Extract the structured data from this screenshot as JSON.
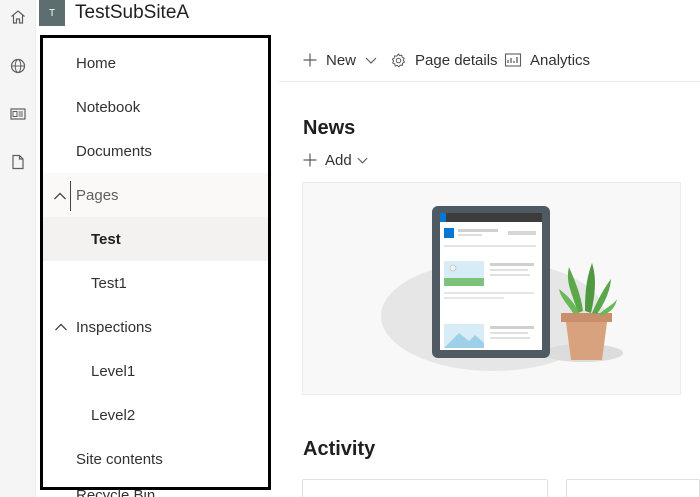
{
  "app_bar": {
    "icons": [
      "home-icon",
      "globe-icon",
      "news-icon",
      "document-icon"
    ]
  },
  "site": {
    "logo_letter": "T",
    "title": "TestSubSiteA"
  },
  "nav": {
    "items": [
      {
        "label": "Home"
      },
      {
        "label": "Notebook"
      },
      {
        "label": "Documents"
      },
      {
        "label": "Pages",
        "expanded": true
      },
      {
        "label": "Test",
        "selected": true
      },
      {
        "label": "Test1"
      },
      {
        "label": "Inspections",
        "expanded": true
      },
      {
        "label": "Level1"
      },
      {
        "label": "Level2"
      },
      {
        "label": "Site contents"
      }
    ],
    "peek_label": "Recycle Bin"
  },
  "commandbar": {
    "new_label": "New",
    "page_details_label": "Page details",
    "analytics_label": "Analytics"
  },
  "news": {
    "title": "News",
    "add_label": "Add"
  },
  "activity": {
    "title": "Activity"
  },
  "colors": {
    "logo_bg": "#5c6e70",
    "accent": "#0078d4",
    "selected_bg": "#f3f2f1",
    "plant_green": "#5aa84a",
    "pot": "#d9a27e"
  }
}
